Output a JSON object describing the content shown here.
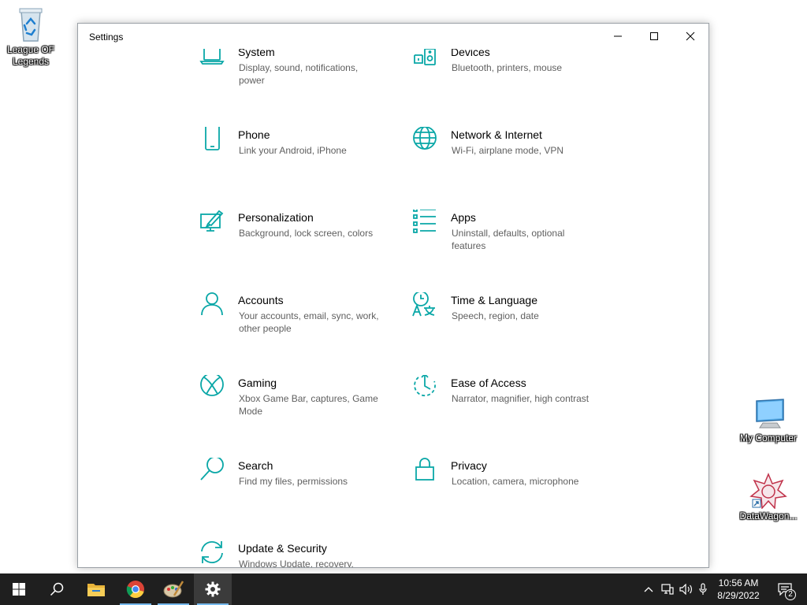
{
  "desktop": {
    "icons": [
      {
        "label": "League OF Legends",
        "icon": "recycle-bin-icon"
      },
      {
        "label": "My Computer",
        "icon": "monitor-icon"
      },
      {
        "label": "DataWagon...",
        "icon": "datawagon-logo-icon"
      }
    ]
  },
  "window": {
    "title": "Settings",
    "accent": "#0aa7a7",
    "controls": {
      "minimize": "minimize-icon",
      "maximize": "maximize-icon",
      "close": "close-icon"
    },
    "tiles": [
      {
        "name": "System",
        "desc": "Display, sound, notifications, power",
        "icon": "laptop-icon"
      },
      {
        "name": "Devices",
        "desc": "Bluetooth, printers, mouse",
        "icon": "devices-icon"
      },
      {
        "name": "Phone",
        "desc": "Link your Android, iPhone",
        "icon": "phone-icon"
      },
      {
        "name": "Network & Internet",
        "desc": "Wi-Fi, airplane mode, VPN",
        "icon": "globe-icon"
      },
      {
        "name": "Personalization",
        "desc": "Background, lock screen, colors",
        "icon": "paint-icon"
      },
      {
        "name": "Apps",
        "desc": "Uninstall, defaults, optional features",
        "icon": "apps-list-icon"
      },
      {
        "name": "Accounts",
        "desc": "Your accounts, email, sync, work, other people",
        "icon": "person-icon"
      },
      {
        "name": "Time & Language",
        "desc": "Speech, region, date",
        "icon": "time-language-icon"
      },
      {
        "name": "Gaming",
        "desc": "Xbox Game Bar, captures, Game Mode",
        "icon": "xbox-icon"
      },
      {
        "name": "Ease of Access",
        "desc": "Narrator, magnifier, high contrast",
        "icon": "ease-of-access-icon"
      },
      {
        "name": "Search",
        "desc": "Find my files, permissions",
        "icon": "search-icon"
      },
      {
        "name": "Privacy",
        "desc": "Location, camera, microphone",
        "icon": "lock-icon"
      },
      {
        "name": "Update & Security",
        "desc": "Windows Update, recovery,",
        "icon": "sync-icon"
      }
    ]
  },
  "taskbar": {
    "items": [
      "windows-start-icon",
      "search-icon",
      "file-explorer-icon",
      "chrome-icon",
      "paint-app-icon",
      "settings-gear-icon"
    ],
    "tray": [
      "chevron-up-icon",
      "network-icon",
      "volume-icon",
      "microphone-icon"
    ],
    "time": "10:56 AM",
    "date": "8/29/2022",
    "notifications_count": "2"
  }
}
